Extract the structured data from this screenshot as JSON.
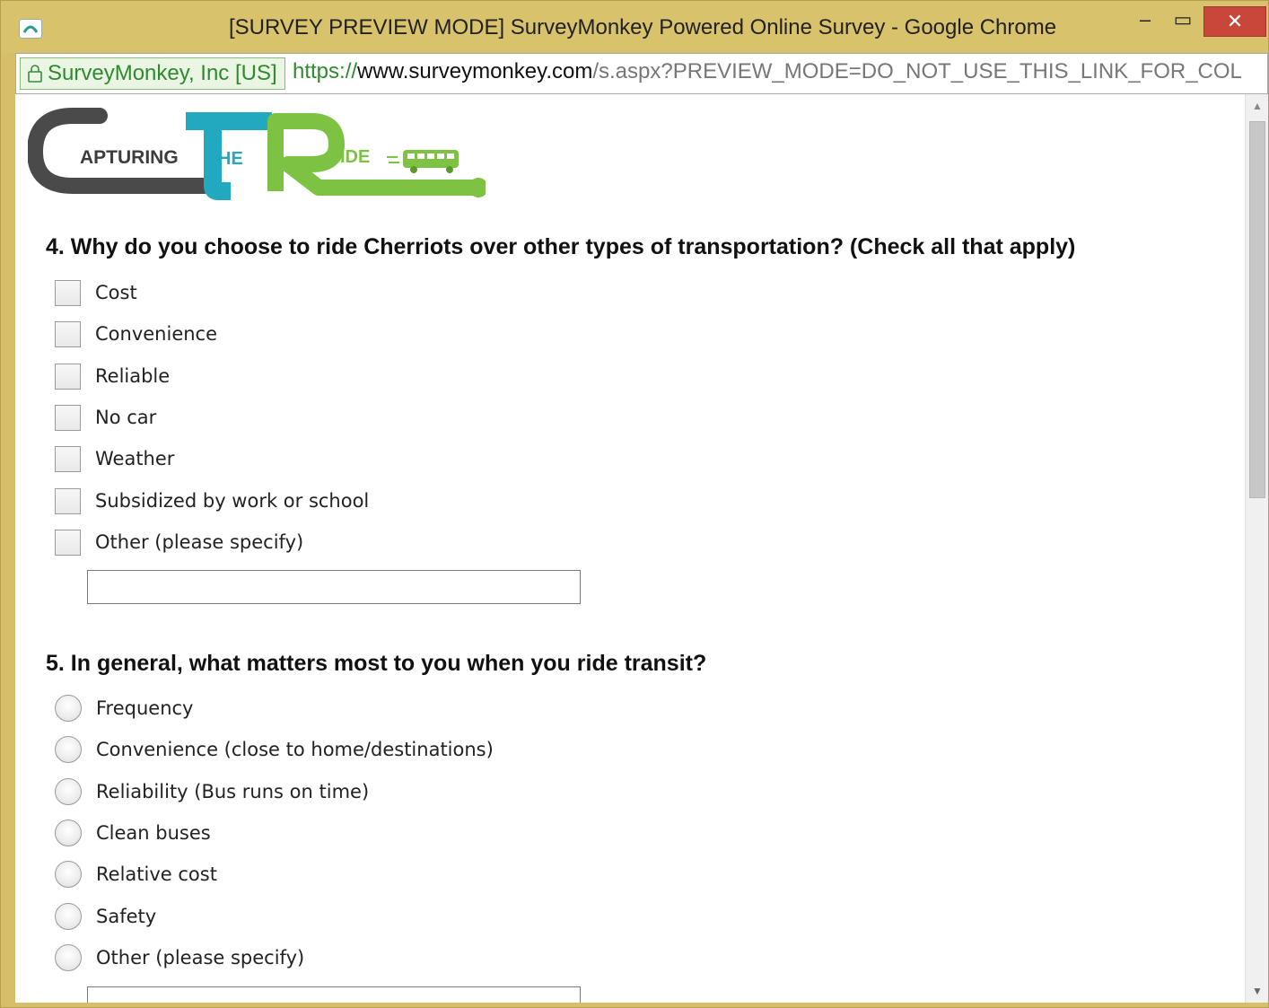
{
  "window": {
    "title": "[SURVEY PREVIEW MODE] SurveyMonkey Powered Online Survey - Google Chrome",
    "minimize_glyph": "–",
    "maximize_glyph": "▭",
    "close_glyph": "✕"
  },
  "addressbar": {
    "ev_label": "SurveyMonkey, Inc [US]",
    "url_scheme": "https://",
    "url_host": "www.surveymonkey.com",
    "url_path": "/s.aspx?PREVIEW_MODE=DO_NOT_USE_THIS_LINK_FOR_COL"
  },
  "logo": {
    "big_c": "C",
    "apturing": "APTURING",
    "big_t": "T",
    "he": "HE",
    "big_r": "R",
    "ide": "IDE",
    "colors": {
      "gray": "#4a4a4a",
      "teal": "#22a9bf",
      "green": "#7dc242"
    }
  },
  "questions": [
    {
      "title": "4. Why do you choose to ride Cherriots over other types of transportation? (Check all that apply)",
      "type": "checkbox",
      "options": [
        "Cost",
        "Convenience",
        "Reliable",
        "No car",
        "Weather",
        "Subsidized by work or school",
        "Other (please specify)"
      ]
    },
    {
      "title": "5. In general, what matters most to you when you ride transit?",
      "type": "radio",
      "options": [
        "Frequency",
        "Convenience (close to home/destinations)",
        "Reliability (Bus runs on time)",
        "Clean buses",
        "Relative cost",
        "Safety",
        "Other (please specify)"
      ]
    }
  ],
  "icons": {
    "app": "surveymonkey-icon",
    "lock": "lock-icon",
    "scroll_up": "▲",
    "scroll_down": "▼"
  }
}
